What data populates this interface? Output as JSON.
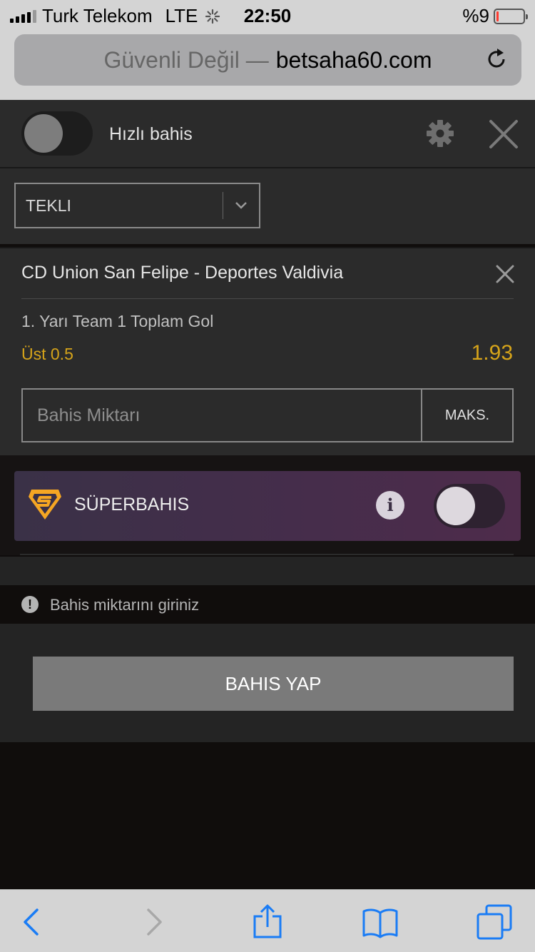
{
  "status_bar": {
    "carrier": "Turk Telekom",
    "network": "LTE",
    "time": "22:50",
    "battery_percent": "%9",
    "battery_level": 0.09
  },
  "browser": {
    "insecure_label": "Güvenli Değil —",
    "host": "betsaha60.com",
    "icons": [
      "reload-icon",
      "back-icon",
      "forward-icon",
      "share-icon",
      "bookmarks-icon",
      "tabs-icon"
    ]
  },
  "betslip": {
    "quick_bet_label": "Hızlı bahis",
    "quick_bet_on": false,
    "bet_type": "TEKLI",
    "event": "CD Union San Felipe - Deportes Valdivia",
    "market": "1. Yarı Team 1 Toplam Gol",
    "selection": "Üst 0.5",
    "odds": "1.93",
    "stake_placeholder": "Bahis Miktarı",
    "stake_value": "",
    "max_label": "MAKS."
  },
  "superbet": {
    "label": "SÜPERBAHIS",
    "info_glyph": "i",
    "enabled": false
  },
  "message": {
    "icon_glyph": "!",
    "text": "Bahis miktarını giriniz"
  },
  "submit_label": "BAHIS YAP",
  "colors": {
    "accent_gold": "#d6a41a",
    "panel": "#2b2b2b",
    "background": "#100d0c",
    "button": "#7a7a7a",
    "ios_blue": "#1a7cf5"
  }
}
